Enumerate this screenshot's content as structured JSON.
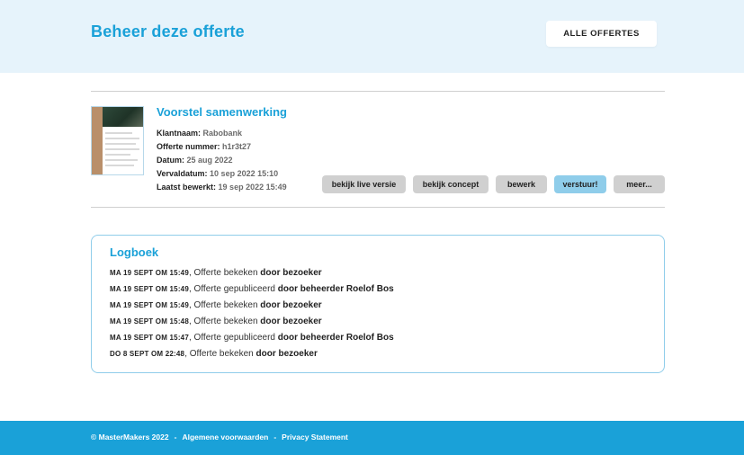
{
  "header": {
    "title": "Beheer deze offerte",
    "all_offers_label": "ALLE OFFERTES"
  },
  "offer": {
    "title": "Voorstel samenwerking",
    "fields": [
      {
        "label": "Klantnaam:",
        "value": "Rabobank"
      },
      {
        "label": "Offerte nummer:",
        "value": "h1r3t27"
      },
      {
        "label": "Datum:",
        "value": "25 aug 2022"
      },
      {
        "label": "Vervaldatum:",
        "value": "10 sep 2022 15:10"
      },
      {
        "label": "Laatst bewerkt:",
        "value": "19 sep 2022 15:49"
      }
    ],
    "actions": [
      {
        "label": "bekijk live versie"
      },
      {
        "label": "bekijk concept"
      },
      {
        "label": "bewerk"
      },
      {
        "label": "verstuur!"
      },
      {
        "label": "meer..."
      }
    ]
  },
  "log": {
    "title": "Logboek",
    "entries": [
      {
        "date": "MA 19 SEPT OM 15:49",
        "action": ", Offerte bekeken ",
        "actor": "door bezoeker"
      },
      {
        "date": "MA 19 SEPT OM 15:49",
        "action": ", Offerte gepubliceerd ",
        "actor": "door beheerder Roelof Bos"
      },
      {
        "date": "MA 19 SEPT OM 15:49",
        "action": ", Offerte bekeken ",
        "actor": "door bezoeker"
      },
      {
        "date": "MA 19 SEPT OM 15:48",
        "action": ", Offerte bekeken ",
        "actor": "door bezoeker"
      },
      {
        "date": "MA 19 SEPT OM 15:47",
        "action": ", Offerte gepubliceerd ",
        "actor": "door beheerder Roelof Bos"
      },
      {
        "date": "DO 8 SEPT OM 22:48",
        "action": ", Offerte bekeken ",
        "actor": "door bezoeker"
      }
    ]
  },
  "footer": {
    "copyright": "© MasterMakers 2022",
    "separator": "-",
    "terms": "Algemene voorwaarden",
    "privacy": "Privacy Statement"
  },
  "colors": {
    "accent": "#1aa1d8",
    "header_bg": "#e6f3fb",
    "primary_button": "#8fcdea",
    "button": "#d0d0d0"
  }
}
